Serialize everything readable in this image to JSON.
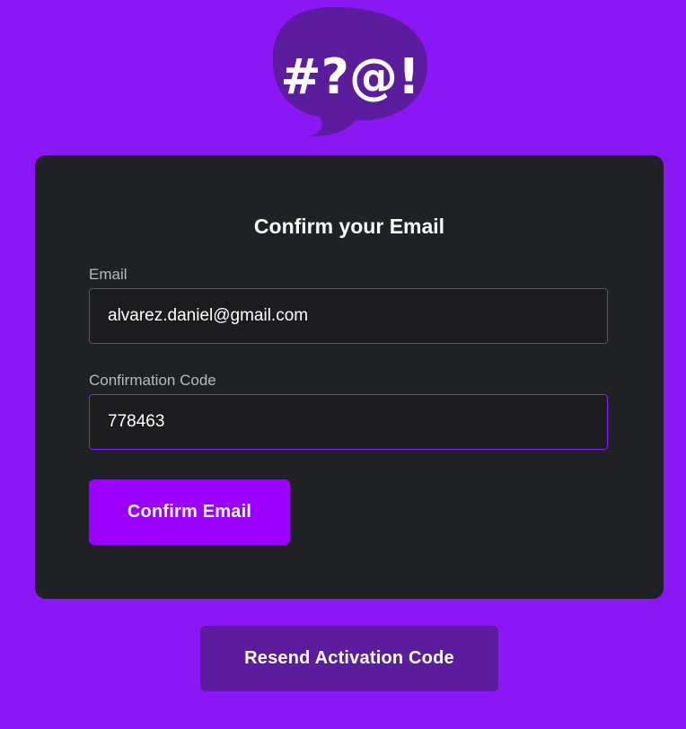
{
  "logo": {
    "text": "#?@!",
    "bubble_color": "#5b1c9e"
  },
  "form": {
    "title": "Confirm your Email",
    "email_label": "Email",
    "email_value": "alvarez.daniel@gmail.com",
    "code_label": "Confirmation Code",
    "code_value": "778463",
    "confirm_button": "Confirm Email"
  },
  "resend_button": "Resend Activation Code",
  "colors": {
    "background": "#8b17f4",
    "card": "#202124",
    "primary_button": "#9b00ff",
    "secondary_button": "#5b1c9e",
    "focus_border": "#8e1aff"
  }
}
